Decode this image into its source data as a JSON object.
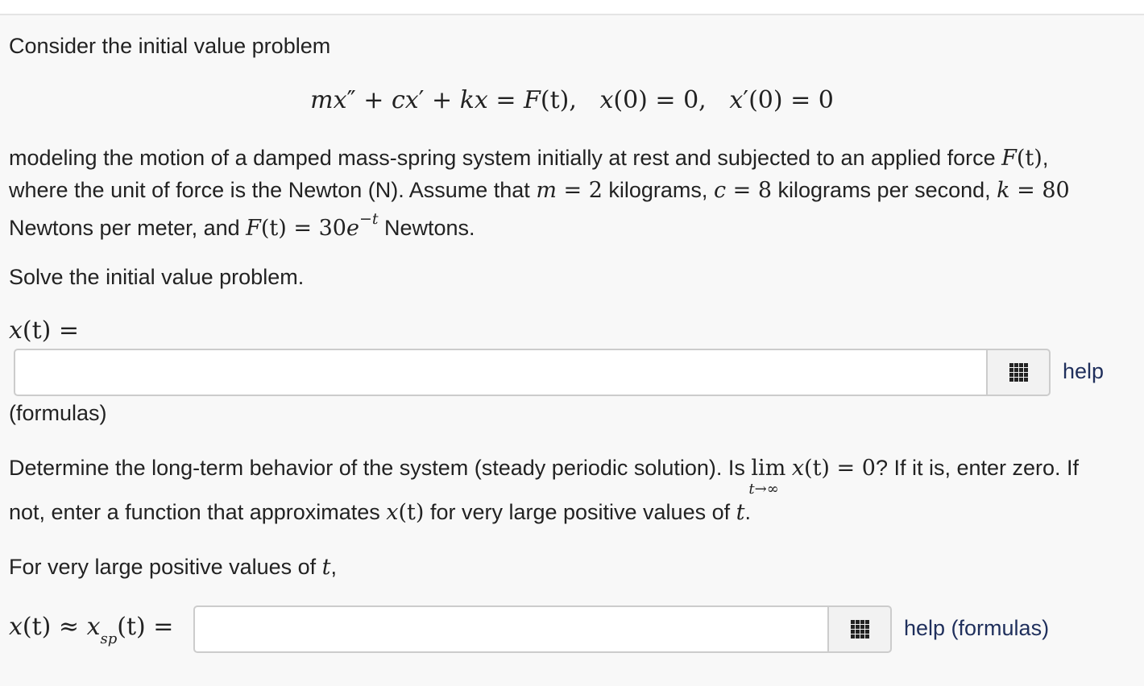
{
  "intro": "Consider the initial value problem",
  "equation": {
    "lhs_m": "m",
    "lhs_x": "x",
    "pp": "″",
    "plus1": " + ",
    "c": "c",
    "x2": "x",
    "p": "′",
    "plus2": " + ",
    "k": "k",
    "x3": "x",
    "eq": " = ",
    "F": "F",
    "t1": "(t),",
    "ic1_x": "x",
    "ic1_rest": "(0) = 0,",
    "ic2_x": "x",
    "ic2_p": "′",
    "ic2_rest": "(0) = 0"
  },
  "paragraph1": {
    "line1_a": "modeling the motion of a damped mass-spring system initially at rest and subjected to an applied force ",
    "line1_F": "F",
    "line1_t": "(t)",
    "line1_end": ",",
    "line2_a": "where the unit of force is the Newton (N). Assume that ",
    "line2_m": "m",
    "line2_m_eq": " = 2",
    "line2_b": " kilograms, ",
    "line2_c": "c",
    "line2_c_eq": " = 8",
    "line2_c2": " kilograms per second, ",
    "line2_k": "k",
    "line2_k_eq": " = 80",
    "line3_a": "Newtons per meter, and ",
    "line3_F": "F",
    "line3_t": "(t) = 30",
    "line3_e": "e",
    "line3_exp": "−t",
    "line3_b": " Newtons."
  },
  "solve_prompt": "Solve the initial value problem.",
  "answer1": {
    "label_x": "x",
    "label_rest": "(t) =",
    "value": "",
    "placeholder": "",
    "help_label": "help",
    "formulas_label": "(formulas)"
  },
  "paragraph2": {
    "line1_a": "Determine the long-term behavior of the system (steady periodic solution). Is ",
    "lim": "lim",
    "lim_sub": "t→∞",
    "lim_x": "x",
    "lim_rest": "(t) = 0",
    "line1_b": "? If it is, enter zero. If",
    "line2_a": "not, enter a function that approximates ",
    "line2_x": "x",
    "line2_t": "(t)",
    "line2_b": " for very large positive values of ",
    "line2_tt": "t",
    "line2_end": "."
  },
  "large_prompt": {
    "a": "For very large positive values of ",
    "t": "t",
    "end": ","
  },
  "answer2": {
    "label_x": "x",
    "label_t": "(t) ≈ ",
    "label_xsp": "x",
    "label_sub": "sp",
    "label_rest": "(t) =",
    "value": "",
    "placeholder": "",
    "help_label": "help (formulas)"
  },
  "icons": {
    "palette": "grid-icon"
  }
}
